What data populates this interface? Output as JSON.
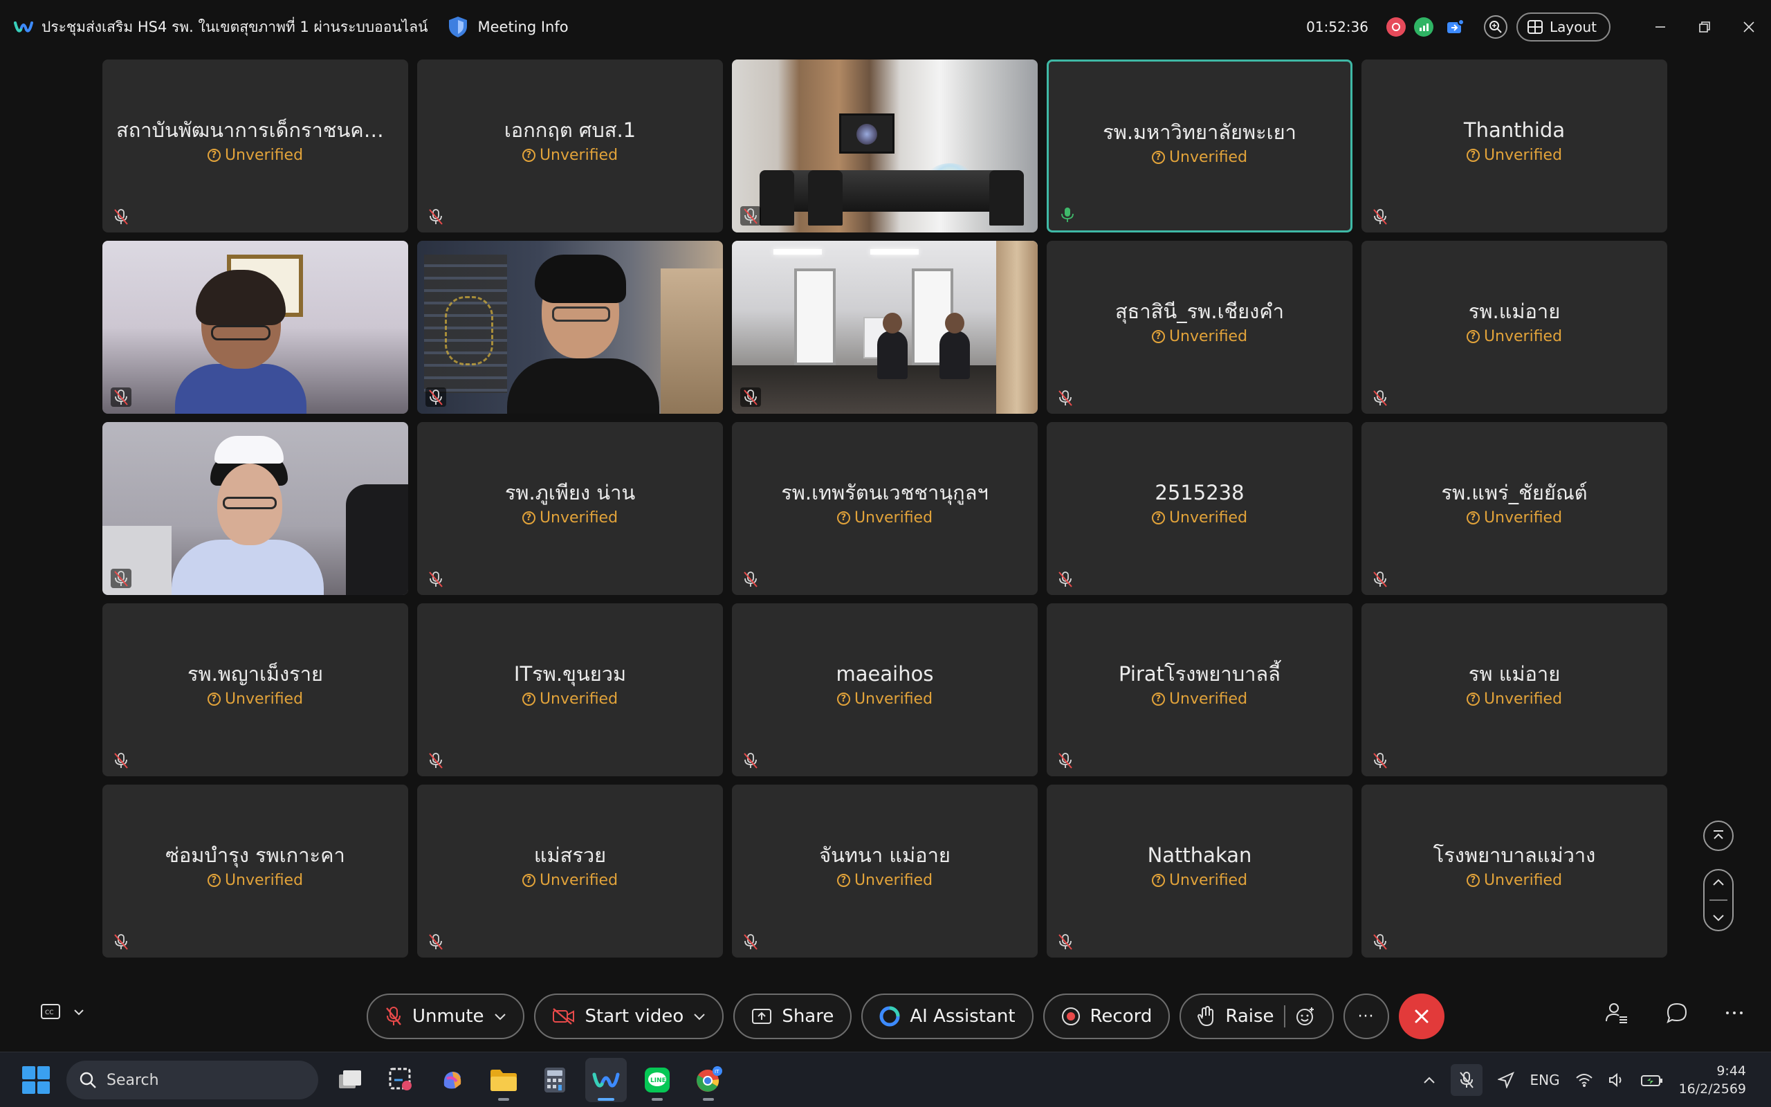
{
  "window": {
    "title": "ประชุมส่งเสริม HS4 รพ. ในเขตสุขภาพที่ 1 ผ่านระบบออนไลน์",
    "meeting_info_label": "Meeting Info",
    "timer": "01:52:36",
    "layout_label": "Layout"
  },
  "unverified_label": "Unverified",
  "tiles": [
    {
      "name": "สถาบันพัฒนาการเด็กราชนครินทร์",
      "type": "name"
    },
    {
      "name": "เอกกฤต ศบส.1",
      "type": "name"
    },
    {
      "name": "",
      "type": "video",
      "scene": "office"
    },
    {
      "name": "รพ.มหาวิทยาลัยพะเยา",
      "type": "name",
      "active": true
    },
    {
      "name": "Thanthida",
      "type": "name"
    },
    {
      "name": "",
      "type": "video",
      "scene": "cam1"
    },
    {
      "name": "",
      "type": "video",
      "scene": "cam2"
    },
    {
      "name": "",
      "type": "video",
      "scene": "room"
    },
    {
      "name": "สุธาสินี_รพ.เชียงคำ",
      "type": "name"
    },
    {
      "name": "รพ.แม่อาย",
      "type": "name"
    },
    {
      "name": "",
      "type": "video",
      "scene": "cam3"
    },
    {
      "name": "รพ.ภูเพียง น่าน",
      "type": "name"
    },
    {
      "name": "รพ.เทพรัตนเวชชานุกูลฯ",
      "type": "name"
    },
    {
      "name": "2515238",
      "type": "name"
    },
    {
      "name": "รพ.แพร่_ชัยยัณต์",
      "type": "name"
    },
    {
      "name": "รพ.พญาเม็งราย",
      "type": "name"
    },
    {
      "name": "ITรพ.ขุนยวม",
      "type": "name"
    },
    {
      "name": "maeaihos",
      "type": "name"
    },
    {
      "name": "Piratโรงพยาบาลลี้",
      "type": "name"
    },
    {
      "name": "รพ แม่อาย",
      "type": "name"
    },
    {
      "name": "ซ่อมบำรุง รพเกาะคา",
      "type": "name"
    },
    {
      "name": "แม่สรวย",
      "type": "name"
    },
    {
      "name": "จันทนา แม่อาย",
      "type": "name"
    },
    {
      "name": "Natthakan",
      "type": "name"
    },
    {
      "name": "โรงพยาบาลแม่วาง",
      "type": "name"
    }
  ],
  "controls": {
    "unmute": "Unmute",
    "start_video": "Start video",
    "share": "Share",
    "ai_assistant": "AI Assistant",
    "record": "Record",
    "raise": "Raise",
    "more": "···"
  },
  "taskbar": {
    "search_placeholder": "Search",
    "language": "ENG",
    "time": "9:44",
    "date": "16/2/2569"
  },
  "colors": {
    "tile_bg": "#2b2b2b",
    "unverified": "#e2a33a",
    "active_border": "#3fb9a6",
    "end_call": "#e23a3a"
  }
}
